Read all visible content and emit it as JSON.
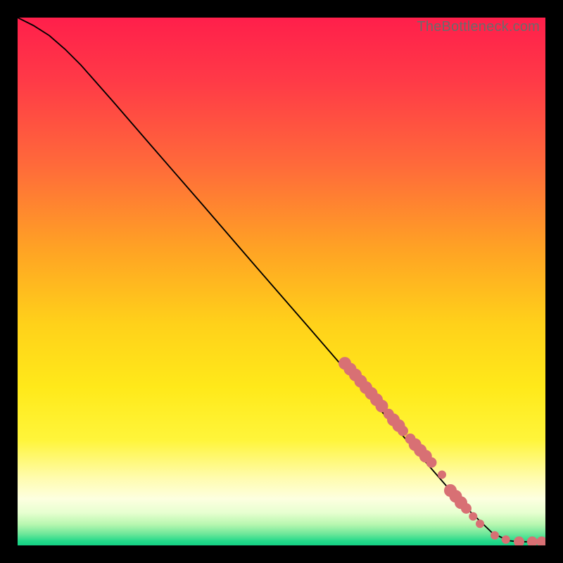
{
  "watermark": "TheBottleneck.com",
  "gradient_stops": [
    {
      "offset": 0.0,
      "color": "#ff1f4b"
    },
    {
      "offset": 0.12,
      "color": "#ff3a47"
    },
    {
      "offset": 0.28,
      "color": "#ff6a3a"
    },
    {
      "offset": 0.44,
      "color": "#ffa324"
    },
    {
      "offset": 0.58,
      "color": "#ffd11a"
    },
    {
      "offset": 0.7,
      "color": "#ffe91a"
    },
    {
      "offset": 0.8,
      "color": "#fff53a"
    },
    {
      "offset": 0.872,
      "color": "#fffcae"
    },
    {
      "offset": 0.912,
      "color": "#fdffe0"
    },
    {
      "offset": 0.938,
      "color": "#e7ffd0"
    },
    {
      "offset": 0.96,
      "color": "#b8f7b0"
    },
    {
      "offset": 0.978,
      "color": "#6fe79a"
    },
    {
      "offset": 0.992,
      "color": "#23d98a"
    },
    {
      "offset": 1.0,
      "color": "#14cf84"
    }
  ],
  "chart_data": {
    "type": "line",
    "title": "",
    "xlabel": "",
    "ylabel": "",
    "xlim": [
      0,
      100
    ],
    "ylim": [
      0,
      100
    ],
    "grid": false,
    "curve": [
      {
        "x": 0,
        "y": 100
      },
      {
        "x": 3,
        "y": 98.5
      },
      {
        "x": 6,
        "y": 96.6
      },
      {
        "x": 9,
        "y": 94.0
      },
      {
        "x": 12,
        "y": 91.0
      },
      {
        "x": 18,
        "y": 84.2
      },
      {
        "x": 25,
        "y": 76.1
      },
      {
        "x": 35,
        "y": 64.6
      },
      {
        "x": 45,
        "y": 53.0
      },
      {
        "x": 55,
        "y": 41.5
      },
      {
        "x": 62,
        "y": 33.4
      },
      {
        "x": 70,
        "y": 24.2
      },
      {
        "x": 78,
        "y": 15.0
      },
      {
        "x": 84,
        "y": 8.1
      },
      {
        "x": 90,
        "y": 2.3
      },
      {
        "x": 93,
        "y": 0.9
      },
      {
        "x": 95,
        "y": 0.7
      },
      {
        "x": 97.5,
        "y": 0.7
      },
      {
        "x": 100,
        "y": 0.7
      }
    ],
    "markers": [
      {
        "x": 62.0,
        "y": 34.5,
        "r": 1.2
      },
      {
        "x": 63.0,
        "y": 33.4,
        "r": 1.2
      },
      {
        "x": 64.0,
        "y": 32.3,
        "r": 1.2
      },
      {
        "x": 65.0,
        "y": 31.1,
        "r": 1.2
      },
      {
        "x": 66.0,
        "y": 29.9,
        "r": 1.2
      },
      {
        "x": 67.0,
        "y": 28.8,
        "r": 1.2
      },
      {
        "x": 68.0,
        "y": 27.6,
        "r": 1.2
      },
      {
        "x": 69.0,
        "y": 26.4,
        "r": 1.2
      },
      {
        "x": 70.3,
        "y": 24.9,
        "r": 1.0
      },
      {
        "x": 71.2,
        "y": 23.8,
        "r": 1.2
      },
      {
        "x": 72.2,
        "y": 22.7,
        "r": 1.2
      },
      {
        "x": 73.0,
        "y": 21.7,
        "r": 1.0
      },
      {
        "x": 74.4,
        "y": 20.2,
        "r": 1.0
      },
      {
        "x": 75.3,
        "y": 19.1,
        "r": 1.2
      },
      {
        "x": 76.3,
        "y": 18.0,
        "r": 1.2
      },
      {
        "x": 77.3,
        "y": 16.9,
        "r": 1.2
      },
      {
        "x": 78.4,
        "y": 15.7,
        "r": 1.0
      },
      {
        "x": 80.4,
        "y": 13.4,
        "r": 0.8
      },
      {
        "x": 82.0,
        "y": 10.4,
        "r": 1.2
      },
      {
        "x": 83.0,
        "y": 9.3,
        "r": 1.2
      },
      {
        "x": 84.0,
        "y": 8.1,
        "r": 1.2
      },
      {
        "x": 85.0,
        "y": 7.0,
        "r": 1.0
      },
      {
        "x": 86.3,
        "y": 5.5,
        "r": 0.8
      },
      {
        "x": 87.6,
        "y": 4.1,
        "r": 0.8
      },
      {
        "x": 90.4,
        "y": 1.9,
        "r": 0.8
      },
      {
        "x": 92.5,
        "y": 1.1,
        "r": 0.8
      },
      {
        "x": 95.0,
        "y": 0.7,
        "r": 1.0
      },
      {
        "x": 97.5,
        "y": 0.7,
        "r": 1.0
      },
      {
        "x": 99.3,
        "y": 0.7,
        "r": 1.0
      }
    ],
    "marker_color": "#d87074",
    "curve_color": "#000000"
  }
}
